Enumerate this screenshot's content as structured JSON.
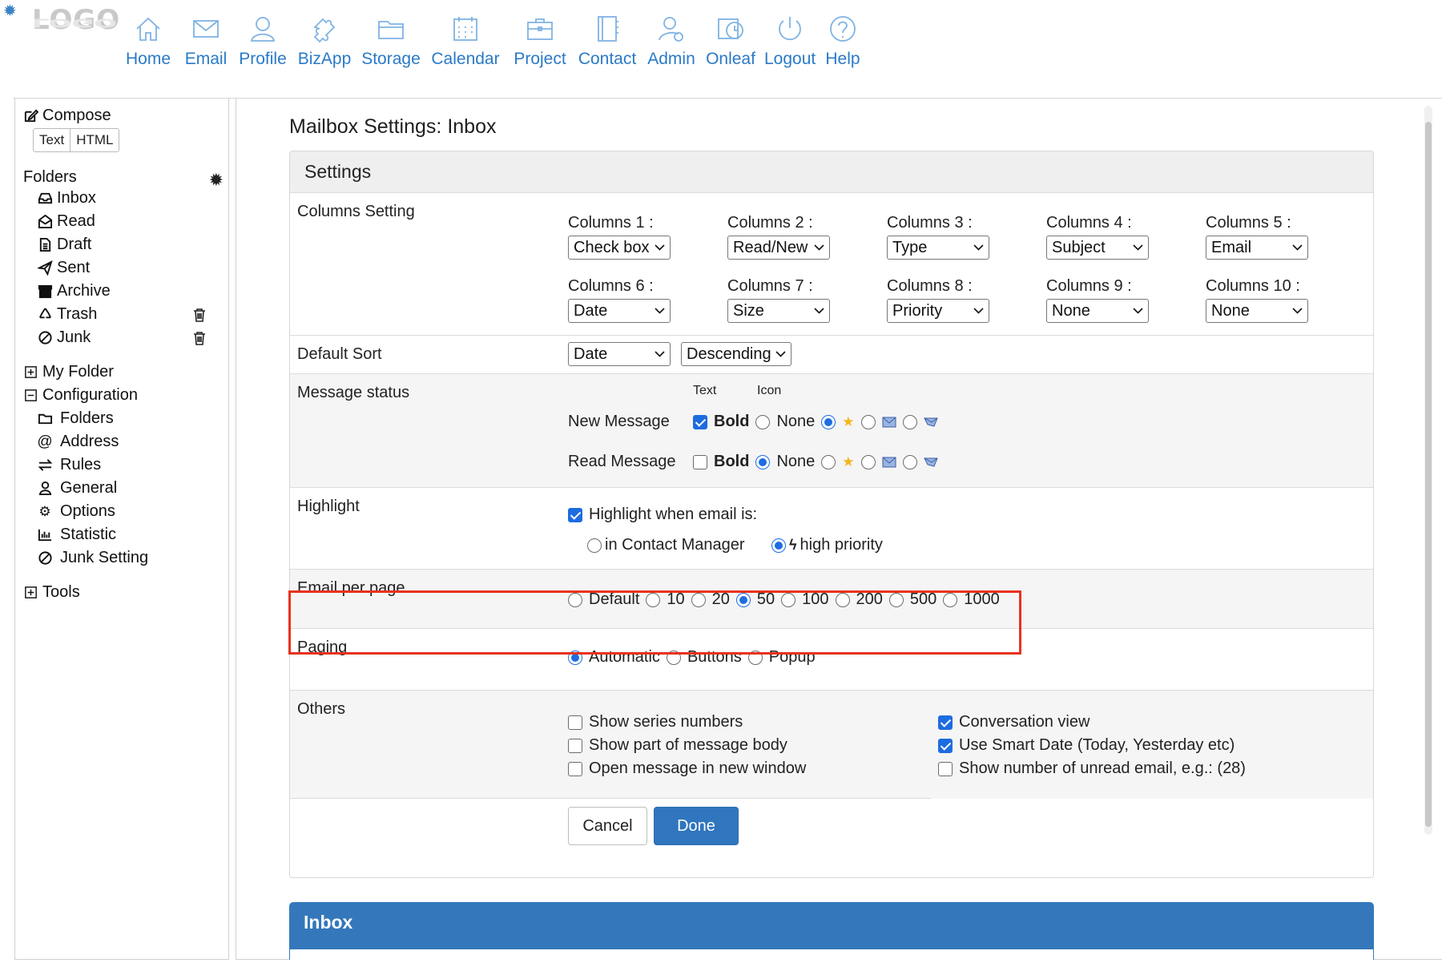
{
  "logo": {
    "text": "LOGO"
  },
  "nav": [
    {
      "label": "Home",
      "icon": "home-icon"
    },
    {
      "label": "Email",
      "icon": "envelope-icon"
    },
    {
      "label": "Profile",
      "icon": "user-icon"
    },
    {
      "label": "BizApp",
      "icon": "puzzle-icon"
    },
    {
      "label": "Storage",
      "icon": "folder-icon"
    },
    {
      "label": "Calendar",
      "icon": "calendar-icon"
    },
    {
      "label": "Project",
      "icon": "briefcase-icon"
    },
    {
      "label": "Contact",
      "icon": "address-book-icon"
    },
    {
      "label": "Admin",
      "icon": "admin-user-icon"
    },
    {
      "label": "Onleaf",
      "icon": "clock-calendar-icon"
    },
    {
      "label": "Logout",
      "icon": "power-icon"
    },
    {
      "label": "Help",
      "icon": "question-icon"
    }
  ],
  "sidebar": {
    "compose": "Compose",
    "format_text": "Text",
    "format_html": "HTML",
    "folders_heading": "Folders",
    "folders": [
      {
        "label": "Inbox",
        "icon": "inbox-icon"
      },
      {
        "label": "Read",
        "icon": "envelope-open-icon"
      },
      {
        "label": "Draft",
        "icon": "file-icon"
      },
      {
        "label": "Sent",
        "icon": "paper-plane-icon"
      },
      {
        "label": "Archive",
        "icon": "archive-icon"
      },
      {
        "label": "Trash",
        "icon": "recycle-icon"
      },
      {
        "label": "Junk",
        "icon": "ban-icon"
      }
    ],
    "my_folder": "My Folder",
    "configuration": "Configuration",
    "config_items": [
      {
        "label": "Folders",
        "icon": "folder-icon"
      },
      {
        "label": "Address",
        "icon": "at-icon"
      },
      {
        "label": "Rules",
        "icon": "exchange-icon"
      },
      {
        "label": "General",
        "icon": "user-icon"
      },
      {
        "label": "Options",
        "icon": "cogs-icon"
      },
      {
        "label": "Statistic",
        "icon": "bar-chart-icon"
      },
      {
        "label": "Junk Setting",
        "icon": "ban-icon"
      }
    ],
    "tools": "Tools"
  },
  "main": {
    "title": "Mailbox Settings: Inbox",
    "settings_heading": "Settings",
    "columns_label": "Columns Setting",
    "columns": [
      {
        "label": "Columns 1 :",
        "value": "Check box"
      },
      {
        "label": "Columns 2 :",
        "value": "Read/New"
      },
      {
        "label": "Columns 3 :",
        "value": "Type"
      },
      {
        "label": "Columns 4 :",
        "value": "Subject"
      },
      {
        "label": "Columns 5 :",
        "value": "Email"
      },
      {
        "label": "Columns 6 :",
        "value": "Date"
      },
      {
        "label": "Columns 7 :",
        "value": "Size"
      },
      {
        "label": "Columns 8 :",
        "value": "Priority"
      },
      {
        "label": "Columns 9 :",
        "value": "None"
      },
      {
        "label": "Columns 10 :",
        "value": "None"
      }
    ],
    "default_sort_label": "Default Sort",
    "sort_field": "Date",
    "sort_order": "Descending",
    "message_status_label": "Message status",
    "text_heading": "Text",
    "icon_heading": "Icon",
    "status_rows": [
      {
        "label": "New Message",
        "bold_checked": true,
        "bold": "Bold",
        "none": "None",
        "selected_icon": "none"
      },
      {
        "label": "Read Message",
        "bold_checked": false,
        "bold": "Bold",
        "none": "None",
        "selected_icon": "bold"
      }
    ],
    "highlight_label": "Highlight",
    "highlight_check": "Highlight when email is:",
    "highlight_checked": true,
    "highlight_opt_contact": "in Contact Manager",
    "highlight_opt_priority": "high priority",
    "highlight_selected": "high priority",
    "email_per_page_label": "Email per page",
    "email_per_page_options": [
      "Default",
      "10",
      "20",
      "50",
      "100",
      "200",
      "500",
      "1000"
    ],
    "email_per_page_selected": "50",
    "paging_label": "Paging",
    "paging_options": [
      "Automatic",
      "Buttons",
      "Popup"
    ],
    "paging_selected": "Automatic",
    "others_label": "Others",
    "others_left": [
      {
        "label": "Show series numbers",
        "checked": false
      },
      {
        "label": "Show part of message body",
        "checked": false
      },
      {
        "label": "Open message in new window",
        "checked": false
      }
    ],
    "others_right": [
      {
        "label": "Conversation view",
        "checked": true
      },
      {
        "label": "Use Smart Date (Today, Yesterday etc)",
        "checked": true
      },
      {
        "label": "Show number of unread email, e.g.: (28)",
        "checked": false
      }
    ],
    "cancel": "Cancel",
    "done": "Done",
    "inbox_heading": "Inbox"
  },
  "colors": {
    "accent": "#2a7ac7",
    "primary_button": "#2f76be",
    "highlight_border": "#e8321e",
    "inbox_bar": "#3478bb"
  }
}
